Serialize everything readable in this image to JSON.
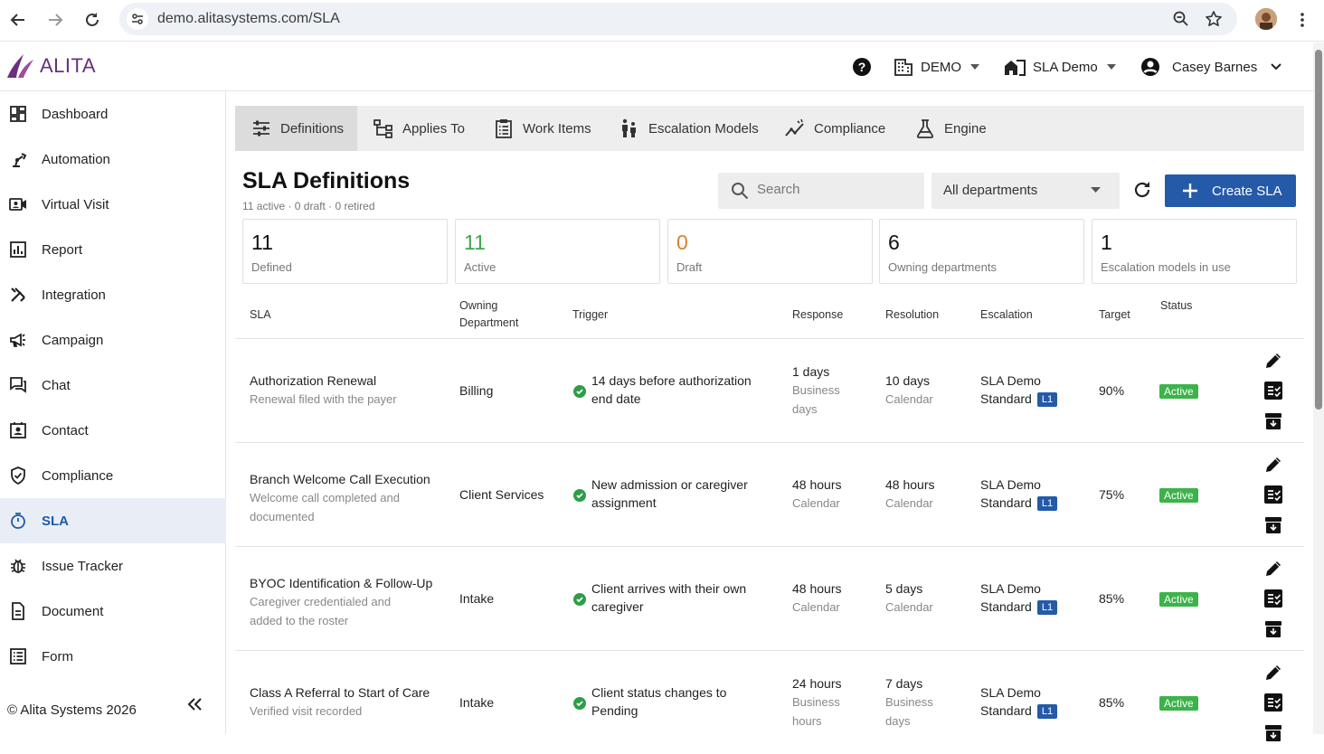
{
  "browser": {
    "url": "demo.alitasystems.com/SLA"
  },
  "header": {
    "logo_text": "ALITA",
    "org": "DEMO",
    "workspace": "SLA Demo",
    "user": "Casey Barnes"
  },
  "sidebar": {
    "items": [
      {
        "label": "Dashboard",
        "icon": "dashboard-icon"
      },
      {
        "label": "Automation",
        "icon": "robot-arm-icon"
      },
      {
        "label": "Virtual Visit",
        "icon": "video-call-icon"
      },
      {
        "label": "Report",
        "icon": "bar-chart-icon"
      },
      {
        "label": "Integration",
        "icon": "tools-icon"
      },
      {
        "label": "Campaign",
        "icon": "megaphone-icon"
      },
      {
        "label": "Chat",
        "icon": "chat-icon"
      },
      {
        "label": "Contact",
        "icon": "contact-card-icon"
      },
      {
        "label": "Compliance",
        "icon": "shield-check-icon"
      },
      {
        "label": "SLA",
        "icon": "timer-icon"
      },
      {
        "label": "Issue Tracker",
        "icon": "bug-icon"
      },
      {
        "label": "Document",
        "icon": "document-icon"
      },
      {
        "label": "Form",
        "icon": "form-list-icon"
      }
    ],
    "active": "SLA",
    "copyright": "© Alita Systems 2026"
  },
  "tabs": [
    {
      "label": "Definitions",
      "icon": "sliders-icon"
    },
    {
      "label": "Applies To",
      "icon": "hierarchy-icon"
    },
    {
      "label": "Work Items",
      "icon": "clipboard-list-icon"
    },
    {
      "label": "Escalation Models",
      "icon": "escalator-icon"
    },
    {
      "label": "Compliance",
      "icon": "trend-icon"
    },
    {
      "label": "Engine",
      "icon": "flask-icon"
    }
  ],
  "page": {
    "title": "SLA Definitions",
    "subtitle": "11 active · 0 draft · 0 retired",
    "search_placeholder": "Search",
    "department_filter": "All departments",
    "create_label": "Create SLA"
  },
  "stats": [
    {
      "value": "11",
      "label": "Defined",
      "color": "#111111"
    },
    {
      "value": "11",
      "label": "Active",
      "color": "#3aa84a"
    },
    {
      "value": "0",
      "label": "Draft",
      "color": "#d9822b"
    },
    {
      "value": "6",
      "label": "Owning departments",
      "color": "#111111"
    },
    {
      "value": "1",
      "label": "Escalation models in use",
      "color": "#111111"
    }
  ],
  "table": {
    "headers": {
      "sla": "SLA",
      "owning_1": "Owning",
      "owning_2": "Department",
      "trigger": "Trigger",
      "response": "Response",
      "resolution": "Resolution",
      "escalation": "Escalation",
      "target": "Target",
      "status": "Status"
    },
    "rows": [
      {
        "name": "Authorization Renewal",
        "desc_1": "Renewal filed with the payer",
        "desc_2": "",
        "department": "Billing",
        "trigger_1": "14 days before authorization",
        "trigger_2": "end date",
        "response": "1 days",
        "response_sub_1": "Business",
        "response_sub_2": "days",
        "resolution": "10 days",
        "resolution_sub_1": "Calendar",
        "resolution_sub_2": "",
        "escalation_1": "SLA Demo",
        "escalation_2": "Standard",
        "level": "L1",
        "target": "90%",
        "status": "Active"
      },
      {
        "name": "Branch Welcome Call Execution",
        "desc_1": "Welcome call completed and",
        "desc_2": "documented",
        "department": "Client Services",
        "trigger_1": "New admission or caregiver",
        "trigger_2": "assignment",
        "response": "48 hours",
        "response_sub_1": "Calendar",
        "response_sub_2": "",
        "resolution": "48 hours",
        "resolution_sub_1": "Calendar",
        "resolution_sub_2": "",
        "escalation_1": "SLA Demo",
        "escalation_2": "Standard",
        "level": "L1",
        "target": "75%",
        "status": "Active"
      },
      {
        "name": "BYOC Identification & Follow-Up",
        "desc_1": "Caregiver credentialed and",
        "desc_2": "added to the roster",
        "department": "Intake",
        "trigger_1": "Client arrives with their own",
        "trigger_2": "caregiver",
        "response": "48 hours",
        "response_sub_1": "Calendar",
        "response_sub_2": "",
        "resolution": "5 days",
        "resolution_sub_1": "Calendar",
        "resolution_sub_2": "",
        "escalation_1": "SLA Demo",
        "escalation_2": "Standard",
        "level": "L1",
        "target": "85%",
        "status": "Active"
      },
      {
        "name": "Class A Referral to Start of Care",
        "desc_1": "Verified visit recorded",
        "desc_2": "",
        "department": "Intake",
        "trigger_1": "Client status changes to",
        "trigger_2": "Pending",
        "response": "24 hours",
        "response_sub_1": "Business",
        "response_sub_2": "hours",
        "resolution": "7 days",
        "resolution_sub_1": "Business",
        "resolution_sub_2": "days",
        "escalation_1": "SLA Demo",
        "escalation_2": "Standard",
        "level": "L1",
        "target": "85%",
        "status": "Active"
      }
    ]
  }
}
